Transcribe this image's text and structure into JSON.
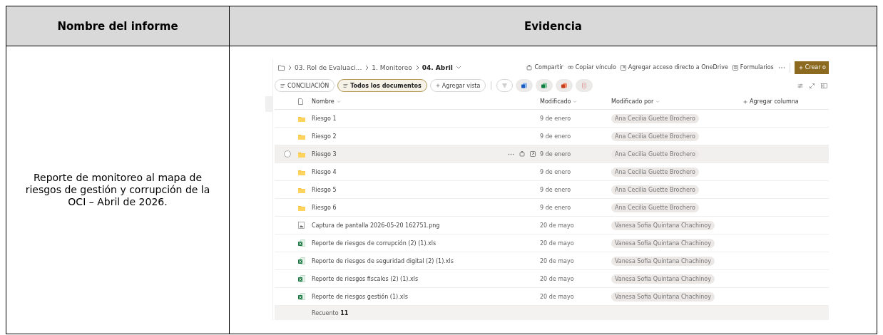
{
  "table": {
    "columns": [
      "Nombre del informe",
      "Evidencia"
    ],
    "rows": [
      {
        "report_name": "Reporte de monitoreo al mapa de riesgos de gestión y corrupción de la OCI – Abril de 2026.",
        "evidence": {
          "breadcrumb": [
            "03. Rol de Evaluaci...",
            "1. Monitoreo",
            "04. Abril"
          ],
          "commands": [
            {
              "label": "Compartir",
              "kind": "share"
            },
            {
              "label": "Copiar vínculo",
              "kind": "link"
            },
            {
              "label": "Agregar acceso directo a OneDrive",
              "kind": "shortcut"
            },
            {
              "label": "Formularios",
              "kind": "forms"
            }
          ],
          "create_button": "Crear o",
          "views": [
            {
              "label": "CONCILIACIÓN",
              "selected": false
            },
            {
              "label": "Todos los documentos",
              "selected": true
            }
          ],
          "add_view": "Agregar vista",
          "columns": {
            "name": "Nombre",
            "modified": "Modificado",
            "modified_by": "Modificado por",
            "add_column": "Agregar columna"
          },
          "files": [
            {
              "name": "Riesgo 1",
              "kind": "folder",
              "modified": "9 de enero",
              "modified_by": "Ana Cecilia Guette Brochero",
              "hovered": false
            },
            {
              "name": "Riesgo 2",
              "kind": "folder",
              "modified": "9 de enero",
              "modified_by": "Ana Cecilia Guette Brochero",
              "hovered": false
            },
            {
              "name": "Riesgo 3",
              "kind": "folder",
              "modified": "9 de enero",
              "modified_by": "Ana Cecilia Guette Brochero",
              "hovered": true
            },
            {
              "name": "Riesgo 4",
              "kind": "folder",
              "modified": "9 de enero",
              "modified_by": "Ana Cecilia Guette Brochero",
              "hovered": false
            },
            {
              "name": "Riesgo 5",
              "kind": "folder",
              "modified": "9 de enero",
              "modified_by": "Ana Cecilia Guette Brochero",
              "hovered": false
            },
            {
              "name": "Riesgo 6",
              "kind": "folder",
              "modified": "9 de enero",
              "modified_by": "Ana Cecilia Guette Brochero",
              "hovered": false
            },
            {
              "name": "Captura de pantalla 2026-05-20 162751.png",
              "kind": "image",
              "modified": "20 de mayo",
              "modified_by": "Vanesa Sofia Quintana Chachinoy",
              "hovered": false
            },
            {
              "name": "Reporte de riesgos de corrupción (2) (1).xls",
              "kind": "excel",
              "modified": "20 de mayo",
              "modified_by": "Vanesa Sofia Quintana Chachinoy",
              "hovered": false
            },
            {
              "name": "Reporte de riesgos de seguridad digital (2) (1).xls",
              "kind": "excel",
              "modified": "20 de mayo",
              "modified_by": "Vanesa Sofia Quintana Chachinoy",
              "hovered": false
            },
            {
              "name": "Reporte de riesgos fiscales (2) (1).xls",
              "kind": "excel",
              "modified": "20 de mayo",
              "modified_by": "Vanesa Sofia Quintana Chachinoy",
              "hovered": false
            },
            {
              "name": "Reporte de riesgos gestión (1).xls",
              "kind": "excel",
              "modified": "20 de mayo",
              "modified_by": "Vanesa Sofia Quintana Chachinoy",
              "hovered": false
            }
          ],
          "footer": "Recuento **11**"
        }
      }
    ]
  }
}
